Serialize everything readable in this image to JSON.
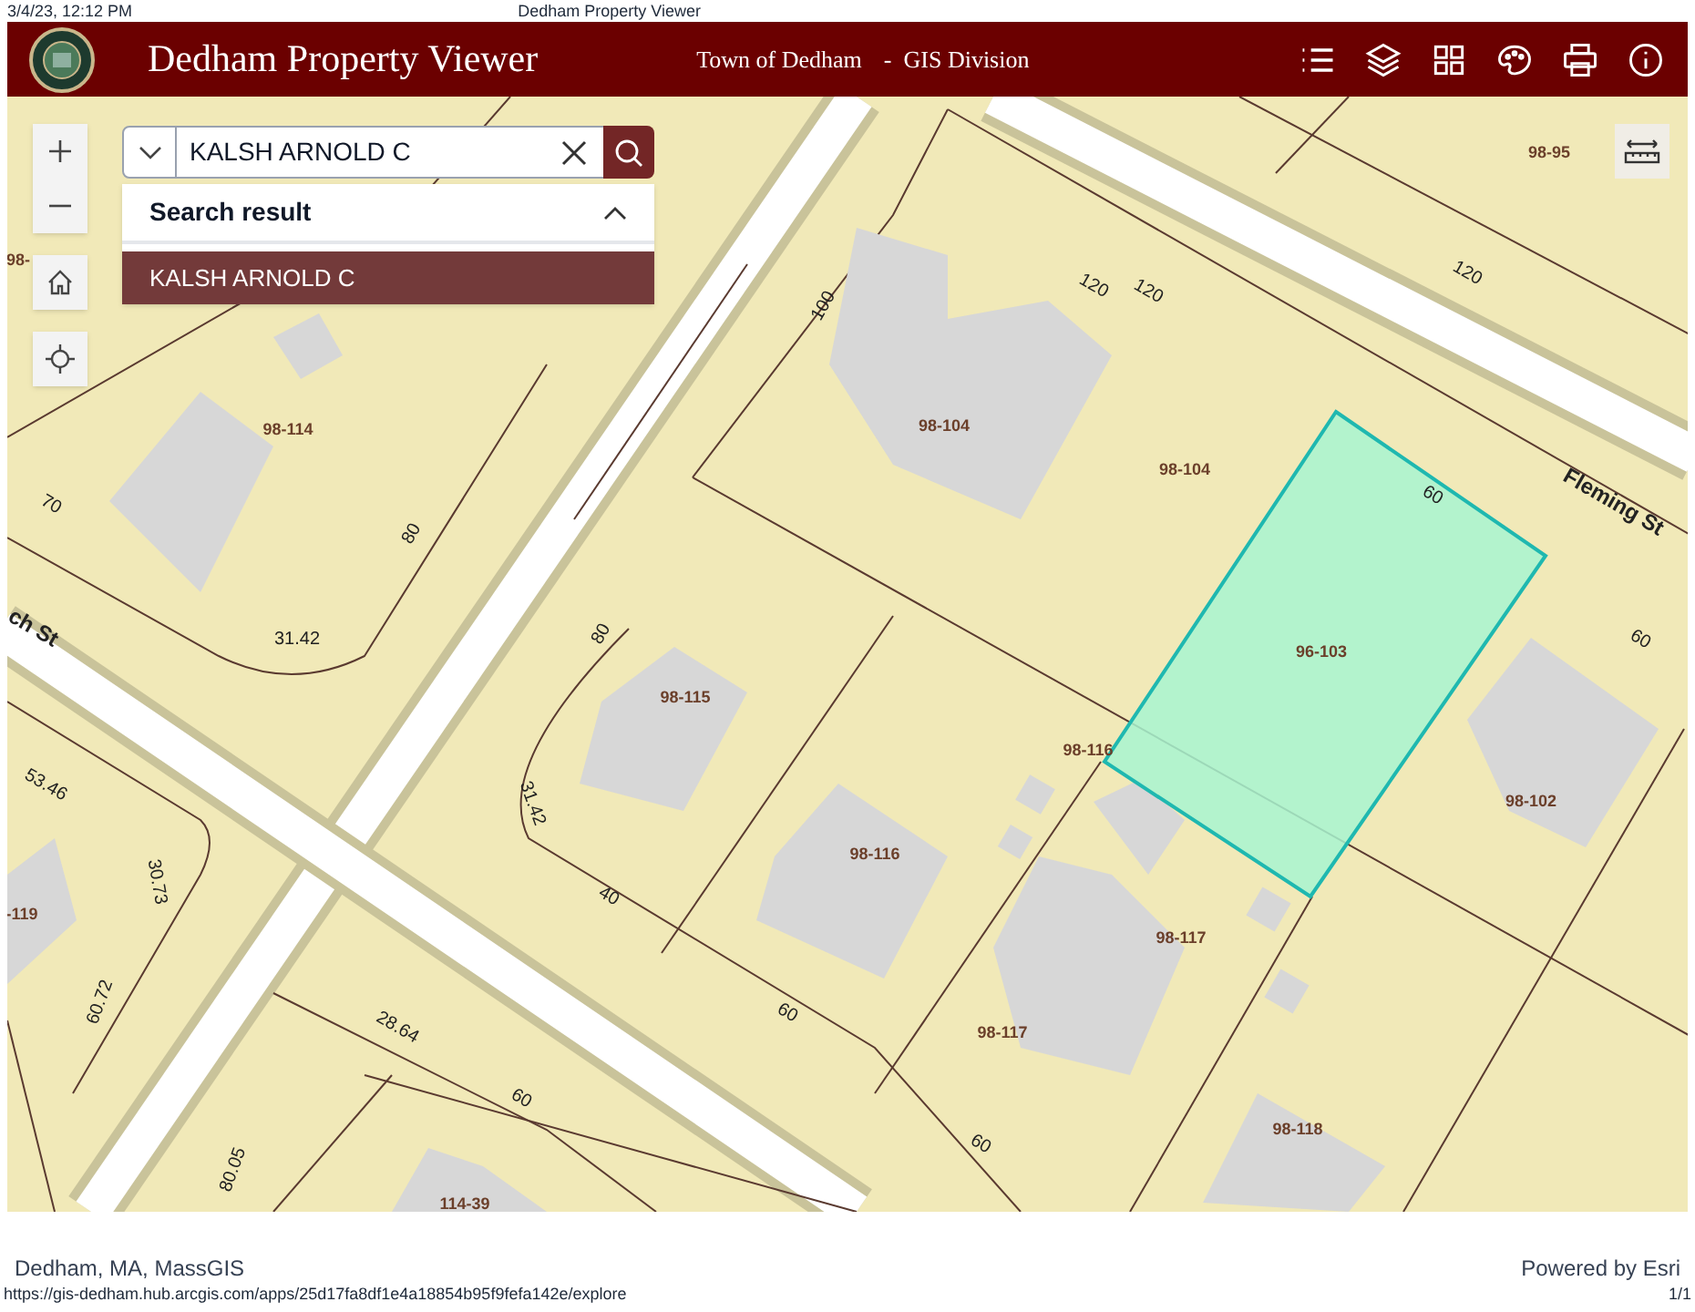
{
  "print_header": {
    "date": "3/4/23, 12:12 PM",
    "title": "Dedham Property Viewer"
  },
  "app_header": {
    "title": "Dedham Property Viewer",
    "organization": "Town of Dedham",
    "division": "-  GIS Division"
  },
  "search": {
    "value": "KALSH ARNOLD C",
    "results_heading": "Search result",
    "results_expanded": true,
    "results": [
      {
        "label": "KALSH ARNOLD C",
        "selected": true
      }
    ]
  },
  "map": {
    "labels": [
      {
        "text": "98-95",
        "kind": "parcel_id"
      },
      {
        "text": "120",
        "kind": "dimension"
      },
      {
        "text": "120",
        "kind": "dimension"
      },
      {
        "text": "120",
        "kind": "dimension"
      },
      {
        "text": "100",
        "kind": "dimension"
      },
      {
        "text": "98-104",
        "kind": "parcel_id"
      },
      {
        "text": "98-104",
        "kind": "parcel_id"
      },
      {
        "text": "60",
        "kind": "dimension"
      },
      {
        "text": "Fleming St",
        "kind": "street"
      },
      {
        "text": "60",
        "kind": "dimension"
      },
      {
        "text": "96-103",
        "kind": "parcel_id"
      },
      {
        "text": "98-116",
        "kind": "parcel_id"
      },
      {
        "text": "98-115",
        "kind": "parcel_id"
      },
      {
        "text": "98-116",
        "kind": "parcel_id"
      },
      {
        "text": "98-102",
        "kind": "parcel_id"
      },
      {
        "text": "98-117",
        "kind": "parcel_id"
      },
      {
        "text": "98-117",
        "kind": "parcel_id"
      },
      {
        "text": "98-118",
        "kind": "parcel_id"
      },
      {
        "text": "98-114",
        "kind": "parcel_id"
      },
      {
        "text": "98-",
        "kind": "parcel_id"
      },
      {
        "text": "70",
        "kind": "dimension"
      },
      {
        "text": "80",
        "kind": "dimension"
      },
      {
        "text": "31.42",
        "kind": "dimension"
      },
      {
        "text": "ch St",
        "kind": "street"
      },
      {
        "text": "80",
        "kind": "dimension"
      },
      {
        "text": "31.42",
        "kind": "dimension"
      },
      {
        "text": "53.46",
        "kind": "dimension"
      },
      {
        "text": "30.73",
        "kind": "dimension"
      },
      {
        "text": "-119",
        "kind": "parcel_id"
      },
      {
        "text": "60.72",
        "kind": "dimension"
      },
      {
        "text": "40",
        "kind": "dimension"
      },
      {
        "text": "60",
        "kind": "dimension"
      },
      {
        "text": "28.64",
        "kind": "dimension"
      },
      {
        "text": "60",
        "kind": "dimension"
      },
      {
        "text": "80.05",
        "kind": "dimension"
      },
      {
        "text": "114-39",
        "kind": "parcel_id"
      },
      {
        "text": "60",
        "kind": "dimension"
      }
    ]
  },
  "attribution": {
    "source": "Dedham, MA, MassGIS",
    "powered_by": "Powered by Esri"
  },
  "print_footer": {
    "url": "https://gis-dedham.hub.arcgis.com/apps/25d17fa8df1e4a18854b95f9fefa142e/explore",
    "page": "1/1"
  }
}
